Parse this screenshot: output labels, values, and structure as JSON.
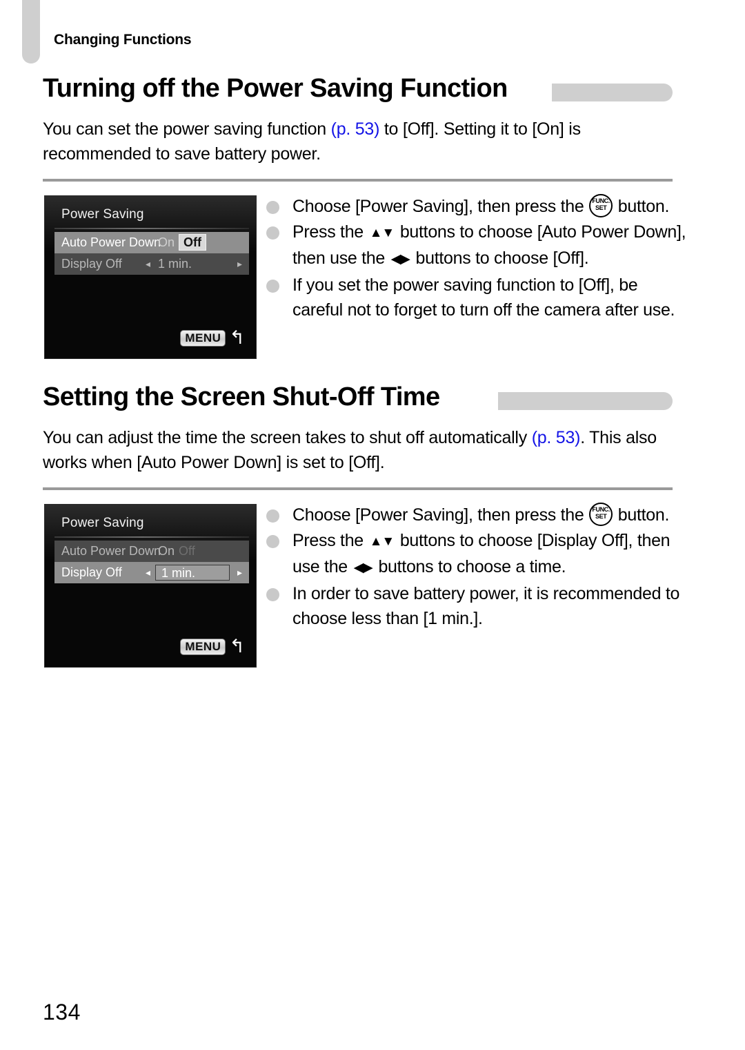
{
  "page": {
    "running_head": "Changing Functions",
    "page_number": "134"
  },
  "sections": [
    {
      "heading": "Turning off the Power Saving Function",
      "intro_before": "You can set the power saving function ",
      "intro_link": "(p. 53)",
      "intro_after": " to [Off]. Setting it to [On] is recommended to save battery power.",
      "screen": {
        "title": "Power Saving",
        "rows": [
          {
            "label": "Auto Power Down",
            "state": "highlighted",
            "option_on": "On",
            "option_off": "Off",
            "selected": "Off"
          },
          {
            "label": "Display Off",
            "state": "dim",
            "value": "1 min.",
            "arrow_left": "◂",
            "arrow_right": "▸"
          }
        ],
        "menu_label": "MENU",
        "back_glyph": "↰"
      },
      "instructions": [
        {
          "parts": [
            {
              "type": "text",
              "value": "Choose [Power Saving], then press the "
            },
            {
              "type": "icon",
              "icon": "func-set-icon",
              "top": "FUNC.",
              "bottom": "SET"
            },
            {
              "type": "text",
              "value": " button."
            }
          ]
        },
        {
          "parts": [
            {
              "type": "text",
              "value": "Press the "
            },
            {
              "type": "icon",
              "icon": "up-down-arrows-icon",
              "glyph": "▲▼"
            },
            {
              "type": "text",
              "value": " buttons to choose [Auto Power Down], then use the "
            },
            {
              "type": "icon",
              "icon": "left-right-arrows-icon",
              "glyph": "◀▶"
            },
            {
              "type": "text",
              "value": " buttons to choose [Off]."
            }
          ]
        },
        {
          "parts": [
            {
              "type": "text",
              "value": "If you set the power saving function to [Off], be careful not to forget to turn off the camera after use."
            }
          ]
        }
      ]
    },
    {
      "heading": "Setting the Screen Shut-Off Time",
      "intro_before": "You can adjust the time the screen takes to shut off automatically ",
      "intro_link": "(p. 53)",
      "intro_after": ". This also works when [Auto Power Down] is set to [Off].",
      "screen": {
        "title": "Power Saving",
        "rows": [
          {
            "label": "Auto Power Down",
            "state": "dim",
            "option_on": "On",
            "option_off": "Off",
            "selected": "On"
          },
          {
            "label": "Display Off",
            "state": "highlighted",
            "value": "1 min.",
            "arrow_left": "◂",
            "arrow_right": "▸"
          }
        ],
        "menu_label": "MENU",
        "back_glyph": "↰"
      },
      "instructions": [
        {
          "parts": [
            {
              "type": "text",
              "value": "Choose [Power Saving], then press the "
            },
            {
              "type": "icon",
              "icon": "func-set-icon",
              "top": "FUNC.",
              "bottom": "SET"
            },
            {
              "type": "text",
              "value": " button."
            }
          ]
        },
        {
          "parts": [
            {
              "type": "text",
              "value": "Press the "
            },
            {
              "type": "icon",
              "icon": "up-down-arrows-icon",
              "glyph": "▲▼"
            },
            {
              "type": "text",
              "value": " buttons to choose [Display Off], then use the "
            },
            {
              "type": "icon",
              "icon": "left-right-arrows-icon",
              "glyph": "◀▶"
            },
            {
              "type": "text",
              "value": " buttons to choose a time."
            }
          ]
        },
        {
          "parts": [
            {
              "type": "text",
              "value": "In order to save battery power, it is recommended to choose less than [1 min.]."
            }
          ]
        }
      ]
    }
  ],
  "colors": {
    "link": "#1414e6",
    "accent_bar": "#cfcfcf",
    "rule": "#9a9a9a",
    "bullet": "#c9c9c9"
  }
}
